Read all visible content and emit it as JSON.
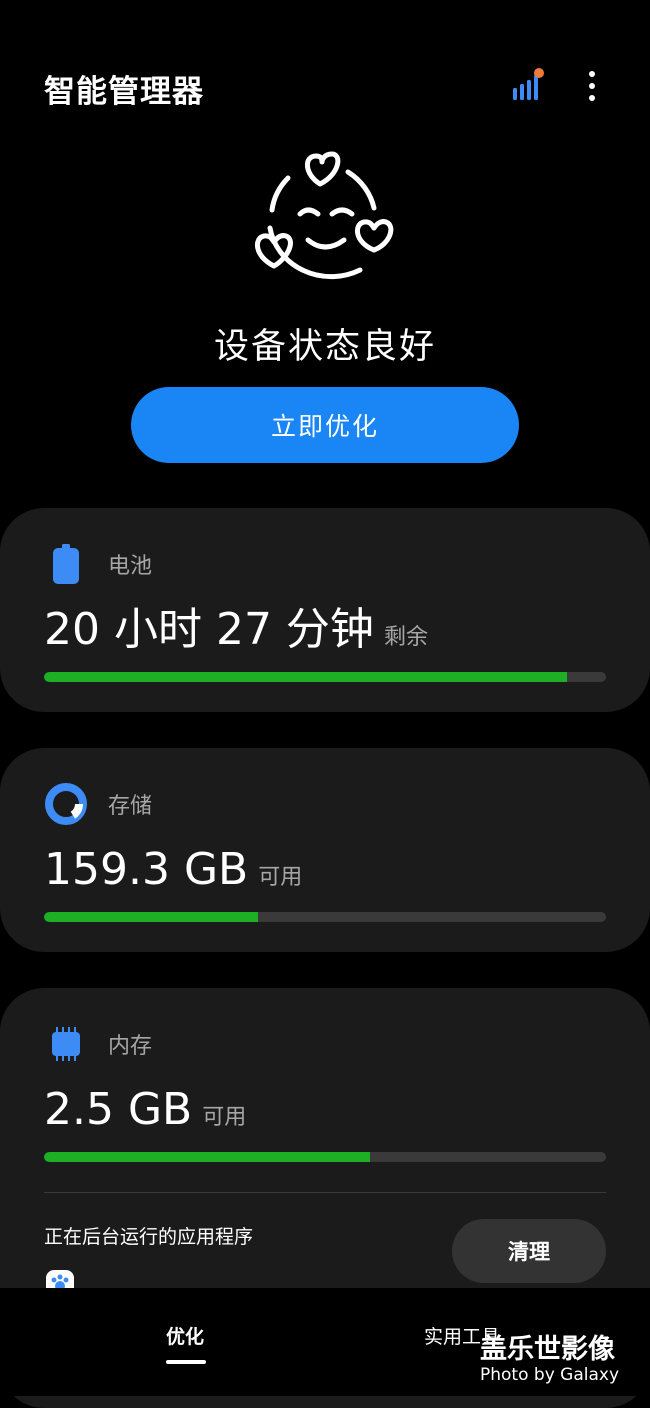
{
  "header": {
    "title": "智能管理器",
    "stats_icon": "bar-chart-with-notification-dot",
    "more_icon": "vertical-ellipsis"
  },
  "hero": {
    "icon": "smiling-face-with-hearts",
    "status": "设备状态良好",
    "optimize_button": "立即优化"
  },
  "cards": {
    "battery": {
      "label": "电池",
      "value": "20 小时 27 分钟",
      "unit": "剩余",
      "level": 0.93
    },
    "storage": {
      "label": "存储",
      "value": "159.3 GB",
      "unit": "可用",
      "level": 0.38
    },
    "memory": {
      "label": "内存",
      "value": "2.5 GB",
      "unit": "可用",
      "level": 0.58,
      "background_apps_title": "正在后台运行的应用程序",
      "clean_button": "清理"
    }
  },
  "bottom_nav": {
    "tabs": [
      {
        "label": "优化",
        "active": true
      },
      {
        "label": "实用工具",
        "active": false
      }
    ]
  },
  "watermark": {
    "line1": "盖乐世影像",
    "line2": "Photo by Galaxy"
  },
  "colors": {
    "accent_blue": "#1a86f6",
    "icon_blue": "#3d8cf5",
    "bar_green": "#1db024",
    "notification_orange": "#f07a3b"
  }
}
